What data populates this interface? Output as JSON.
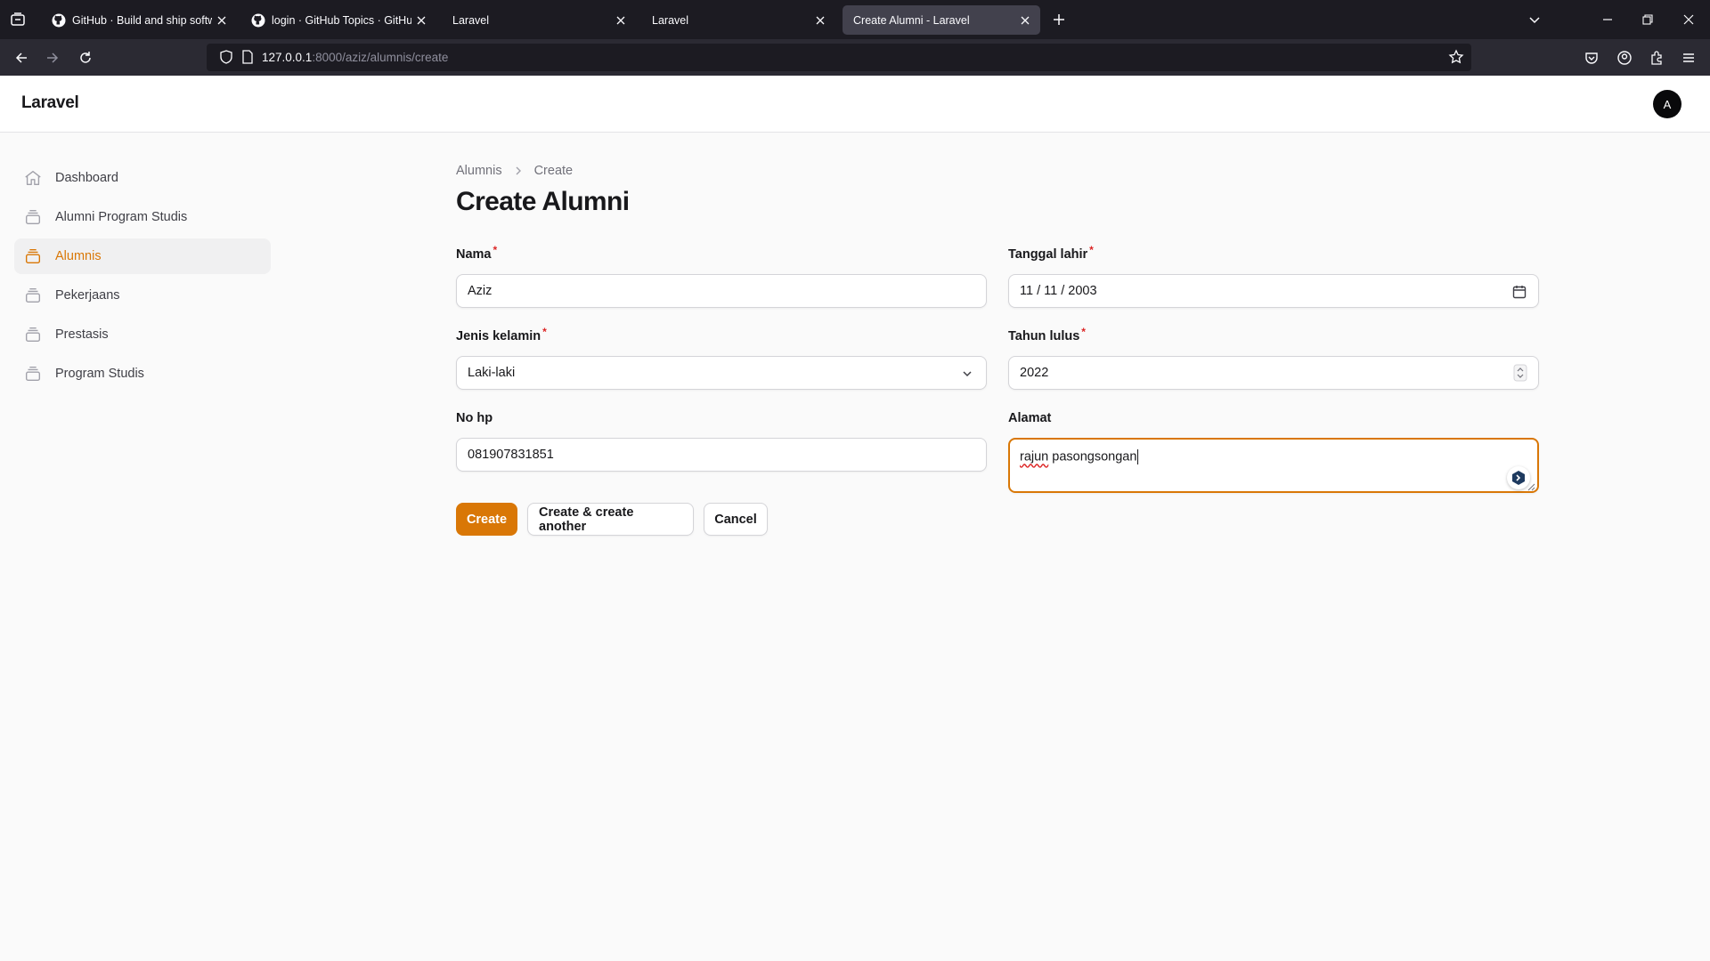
{
  "browser": {
    "tabs": [
      {
        "title": "GitHub · Build and ship softwar",
        "active": false,
        "favicon": "github-icon"
      },
      {
        "title": "login · GitHub Topics · GitHub",
        "active": false,
        "favicon": "github-icon"
      },
      {
        "title": "Laravel",
        "active": false
      },
      {
        "title": "Laravel",
        "active": false
      },
      {
        "title": "Create Alumni - Laravel",
        "active": true
      }
    ],
    "url_host": "127.0.0.1",
    "url_rest": ":8000/aziz/alumnis/create"
  },
  "app": {
    "brand": "Laravel",
    "user_initial": "A"
  },
  "sidebar": {
    "items": [
      {
        "label": "Dashboard",
        "icon": "home-icon"
      },
      {
        "label": "Alumni Program Studis",
        "icon": "stack-icon"
      },
      {
        "label": "Alumnis",
        "icon": "stack-icon",
        "active": true
      },
      {
        "label": "Pekerjaans",
        "icon": "stack-icon"
      },
      {
        "label": "Prestasis",
        "icon": "stack-icon"
      },
      {
        "label": "Program Studis",
        "icon": "stack-icon"
      }
    ]
  },
  "breadcrumb": {
    "parent": "Alumnis",
    "current": "Create"
  },
  "page_title": "Create Alumni",
  "form": {
    "nama": {
      "label": "Nama",
      "required_mark": "*",
      "value": "Aziz"
    },
    "tanggal_lahir": {
      "label": "Tanggal lahir",
      "required_mark": "*",
      "value": "11 / 11 / 2003"
    },
    "jenis_kelamin": {
      "label": "Jenis kelamin",
      "required_mark": "*",
      "value": "Laki-laki"
    },
    "tahun_lulus": {
      "label": "Tahun lulus",
      "required_mark": "*",
      "value": "2022"
    },
    "no_hp": {
      "label": "No hp",
      "value": "081907831851"
    },
    "alamat": {
      "label": "Alamat",
      "value_word1": "rajun",
      "value_rest": " pasongsongan"
    }
  },
  "actions": {
    "create": "Create",
    "create_another": "Create & create another",
    "cancel": "Cancel"
  },
  "colors": {
    "accent": "#d97706",
    "required": "#dc2626"
  }
}
